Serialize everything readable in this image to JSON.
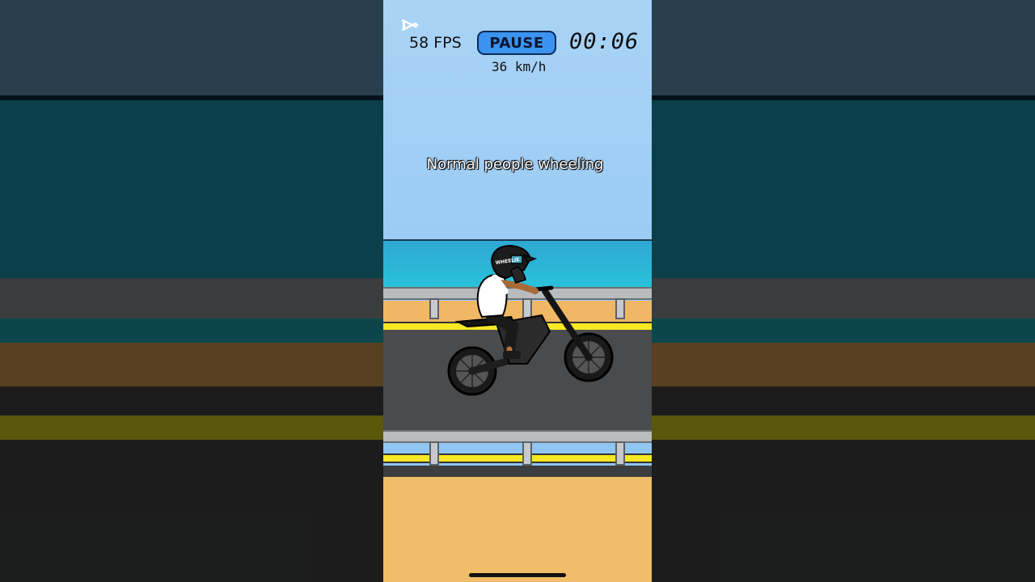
{
  "hud": {
    "fps": "58 FPS",
    "pause_label": "PAUSE",
    "timer": "00:06",
    "speed": "36 km/h",
    "logo_icon": "capcut-logo-icon"
  },
  "caption": "Normal people wheeling",
  "helmet_text": "WHEELIE",
  "colors": {
    "sky": "#9ccbf0",
    "sea": "#2fb3d7",
    "sand": "#f0b764",
    "road": "#4a4b4d",
    "road_line": "#f5e824",
    "pause_button": "#3b93f0"
  }
}
